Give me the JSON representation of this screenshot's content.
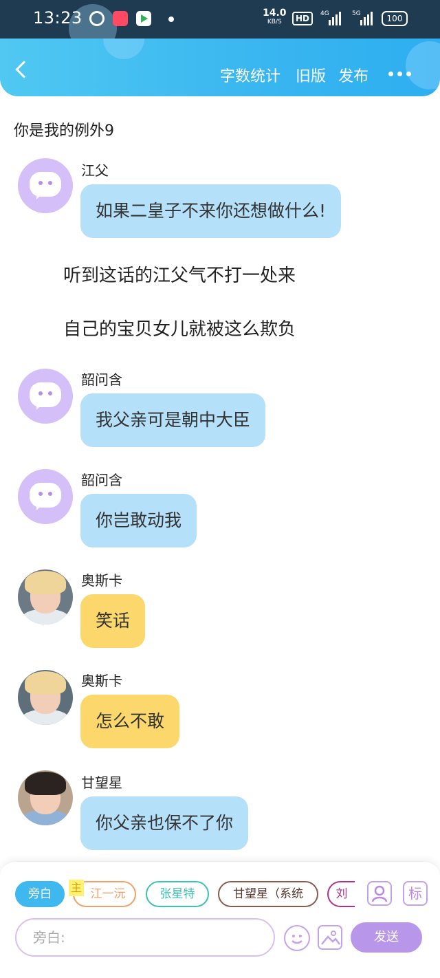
{
  "status_bar": {
    "time": "13:23",
    "speed_value": "14.0",
    "speed_unit": "KB/S",
    "hd_label": "HD",
    "net_4g": "4G",
    "net_5g": "5G",
    "battery": "100"
  },
  "header": {
    "actions": [
      "字数统计",
      "旧版",
      "发布"
    ],
    "accent_color": "#3ab8f0"
  },
  "story_title": "你是我的例外9",
  "messages": [
    {
      "type": "dialogue",
      "sender": "江父",
      "text": "如果二皇子不来你还想做什么!",
      "bubble": "blue",
      "avatar": "default-chat-icon"
    },
    {
      "type": "narration",
      "text": "听到这话的江父气不打一处来"
    },
    {
      "type": "narration",
      "text": "自己的宝贝女儿就被这么欺负"
    },
    {
      "type": "dialogue",
      "sender": "韶问含",
      "text": "我父亲可是朝中大臣",
      "bubble": "blue",
      "avatar": "default-chat-icon"
    },
    {
      "type": "dialogue",
      "sender": "韶问含",
      "text": "你岂敢动我",
      "bubble": "blue",
      "avatar": "default-chat-icon"
    },
    {
      "type": "dialogue",
      "sender": "奥斯卡",
      "text": "笑话",
      "bubble": "yellow",
      "avatar": "photo-blond"
    },
    {
      "type": "dialogue",
      "sender": "奥斯卡",
      "text": "怎么不敢",
      "bubble": "yellow",
      "avatar": "photo-blond"
    },
    {
      "type": "dialogue",
      "sender": "甘望星",
      "text": "你父亲也保不了你",
      "bubble": "blue",
      "avatar": "photo-dark"
    }
  ],
  "composer": {
    "main_tag": "主",
    "characters": [
      {
        "label": "旁白",
        "active": true,
        "color": "#3fb8f0"
      },
      {
        "label": "江一沅",
        "active": false,
        "color": "#f0a06a"
      },
      {
        "label": "张星特",
        "active": false,
        "color": "#3cc3b0"
      },
      {
        "label": "甘望星（系统",
        "active": false,
        "color": "#8a5a4a"
      },
      {
        "label": "刘",
        "active": false,
        "color": "#b0308a"
      }
    ],
    "avatar_button_icon": "person-icon",
    "label_button": "标",
    "placeholder": "旁白:",
    "send_label": "发送",
    "send_color": "#b896ea"
  }
}
